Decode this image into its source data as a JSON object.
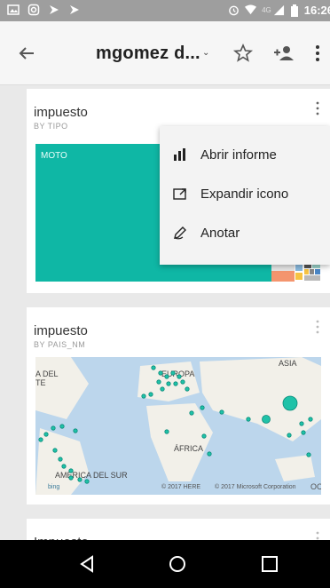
{
  "status_bar": {
    "time": "16:26",
    "network": "4G"
  },
  "app_bar": {
    "title": "mgomez d...",
    "title_caret": "⌄"
  },
  "cards": [
    {
      "title": "impuesto",
      "subtitle": "BY TIPO",
      "treemap_label": "MOTO"
    },
    {
      "title": "impuesto",
      "subtitle": "BY PAIS_NM",
      "map_labels": {
        "europe": "EUROPA",
        "asia": "ASIA",
        "africa": "ÁFRICA",
        "south_america": "AMÉRICA DEL SUR",
        "north_america": "A DEL TE"
      },
      "credits": {
        "bing": "bing",
        "here": "© 2017 HERE",
        "microsoft": "© 2017 Microsoft Corporation",
        "edge": "OC"
      }
    },
    {
      "title": "Impuesto"
    }
  ],
  "context_menu": {
    "items": [
      {
        "label": "Abrir informe",
        "icon": "bar-chart-icon"
      },
      {
        "label": "Expandir icono",
        "icon": "expand-icon"
      },
      {
        "label": "Anotar",
        "icon": "pen-icon"
      }
    ]
  },
  "colors": {
    "treemap": "#0fb7a5",
    "map_water": "#bcd6ec",
    "map_land": "#f2f0e9",
    "point": "#1fc2a8",
    "status_bar": "#9e9e9e"
  }
}
